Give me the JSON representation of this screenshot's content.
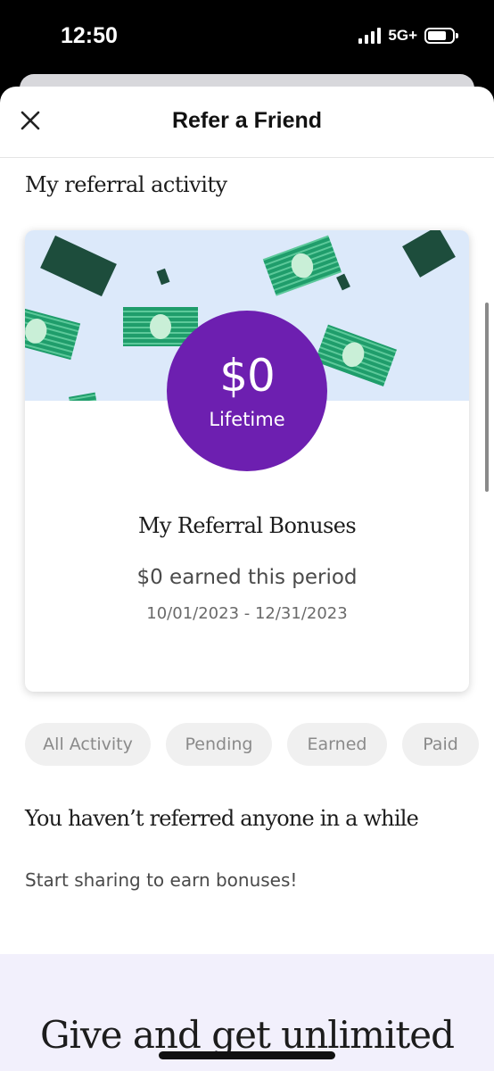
{
  "status_bar": {
    "time": "12:50",
    "network": "5G+"
  },
  "header": {
    "title": "Refer a Friend"
  },
  "section": {
    "title": "My referral activity"
  },
  "card": {
    "amount": "$0",
    "amount_label": "Lifetime",
    "heading": "My Referral Bonuses",
    "earned_text": "$0 earned this period",
    "period": "10/01/2023 - 12/31/2023"
  },
  "filters": [
    "All Activity",
    "Pending",
    "Earned",
    "Paid"
  ],
  "empty_state": {
    "title": "You haven’t referred anyone in a while",
    "subtitle": "Start sharing to earn bonuses!"
  },
  "promo": {
    "text": "Give and get unlimited"
  },
  "colors": {
    "badge": "#6d1fb0",
    "banner": "#dce9fa",
    "money_green": "#1f9d6b",
    "money_dark": "#1d4d3c"
  }
}
